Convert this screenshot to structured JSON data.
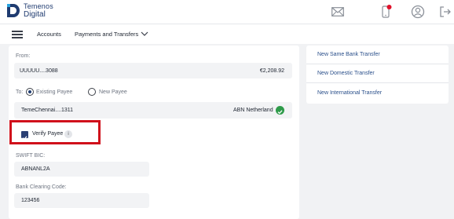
{
  "brand": {
    "line1": "Temenos",
    "line2": "Digital",
    "accent": "#1f3b70"
  },
  "topbar": {
    "icons": [
      "mail-icon",
      "notification-phone-icon",
      "user-profile-icon",
      "logout-icon"
    ],
    "notification_dot_color": "#e0102a"
  },
  "nav": {
    "accounts": "Accounts",
    "payments": "Payments and Transfers"
  },
  "form": {
    "from_label": "From:",
    "from_account": "UUUUU....3088",
    "from_balance": "€2,208.92",
    "to_label": "To:",
    "existing_payee": "Existing Payee",
    "new_payee": "New Payee",
    "selected_payee_option": "Existing Payee",
    "payee_name": "TemeChennai....1311",
    "payee_bank": "ABN Netherland",
    "verify_payee": "Verify Payee",
    "verify_payee_checked": true,
    "swift_label": "SWIFT BIC:",
    "swift_value": "ABNANL2A",
    "clearing_label": "Bank Clearing Code:",
    "clearing_value": "123456"
  },
  "sidebar": {
    "links": [
      "New Same Bank Transfer",
      "New Domestic Transfer",
      "New International Transfer"
    ]
  },
  "colors": {
    "highlight_border": "#d0101b",
    "verified_green": "#2e9b4a",
    "link": "#2a4f8a"
  }
}
